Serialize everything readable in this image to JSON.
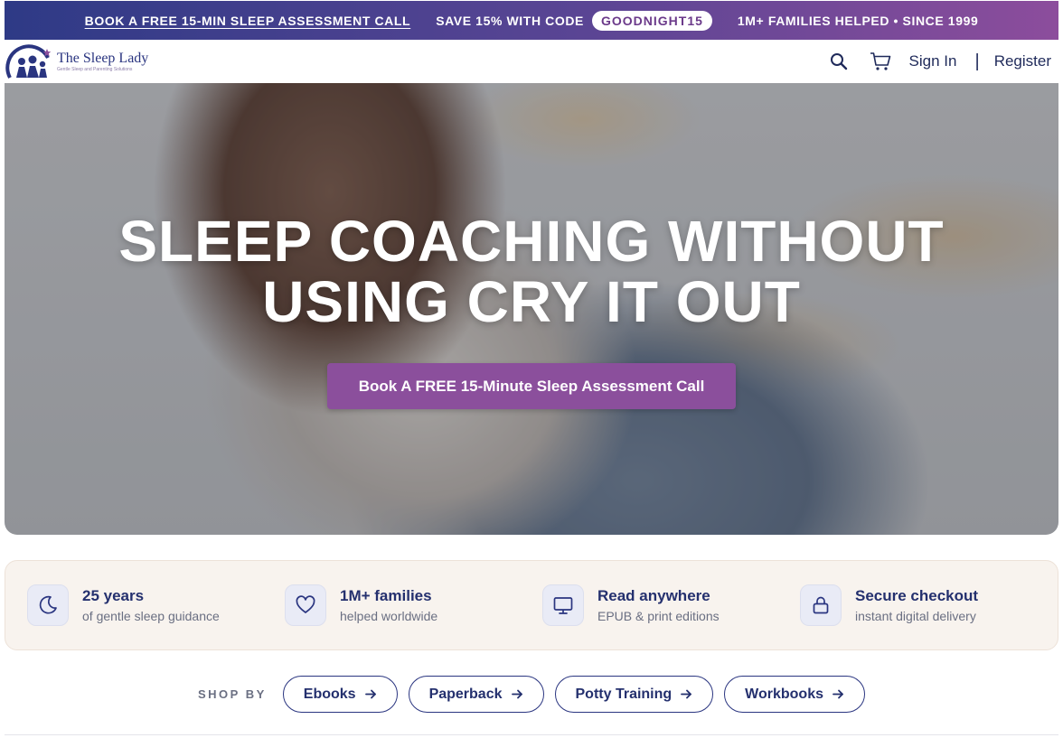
{
  "promo": {
    "link_label": "BOOK A FREE 15-MIN SLEEP ASSESSMENT CALL",
    "code_label": "SAVE 15% WITH CODE",
    "code": "GOODNIGHT15",
    "stat": "1M+ FAMILIES HELPED • SINCE 1999",
    "gradient": [
      "#2e3a86",
      "#8c4d9c"
    ]
  },
  "header": {
    "logo_title": "The Sleep Lady",
    "logo_tagline": "Gentle Sleep and Parenting Solutions",
    "search_icon": "search-icon",
    "cart_icon": "cart-icon",
    "sign_in": "Sign In",
    "divider": "|",
    "register": "Register"
  },
  "hero": {
    "title_line1": "SLEEP COACHING WITHOUT",
    "title_line2": "USING CRY IT OUT",
    "cta": "Book A FREE 15-Minute Sleep Assessment Call",
    "cta_color": "#8b4f9c"
  },
  "features": [
    {
      "icon": "moon-icon",
      "title": "25 years",
      "subtitle": "of gentle sleep guidance"
    },
    {
      "icon": "heart-icon",
      "title": "1M+ families",
      "subtitle": "helped worldwide"
    },
    {
      "icon": "monitor-icon",
      "title": "Read anywhere",
      "subtitle": "EPUB & print editions"
    },
    {
      "icon": "lock-icon",
      "title": "Secure checkout",
      "subtitle": "instant digital delivery"
    }
  ],
  "shop_by": {
    "label": "SHOP BY",
    "items": [
      {
        "label": "Ebooks",
        "icon": "arrow-right-icon"
      },
      {
        "label": "Paperback",
        "icon": "arrow-right-icon"
      },
      {
        "label": "Potty Training",
        "icon": "arrow-right-icon"
      },
      {
        "label": "Workbooks",
        "icon": "arrow-right-icon"
      }
    ]
  },
  "colors": {
    "brand_navy": "#24306e",
    "accent_purple": "#8b4f9c",
    "feature_bg": "#f8f3ee"
  }
}
